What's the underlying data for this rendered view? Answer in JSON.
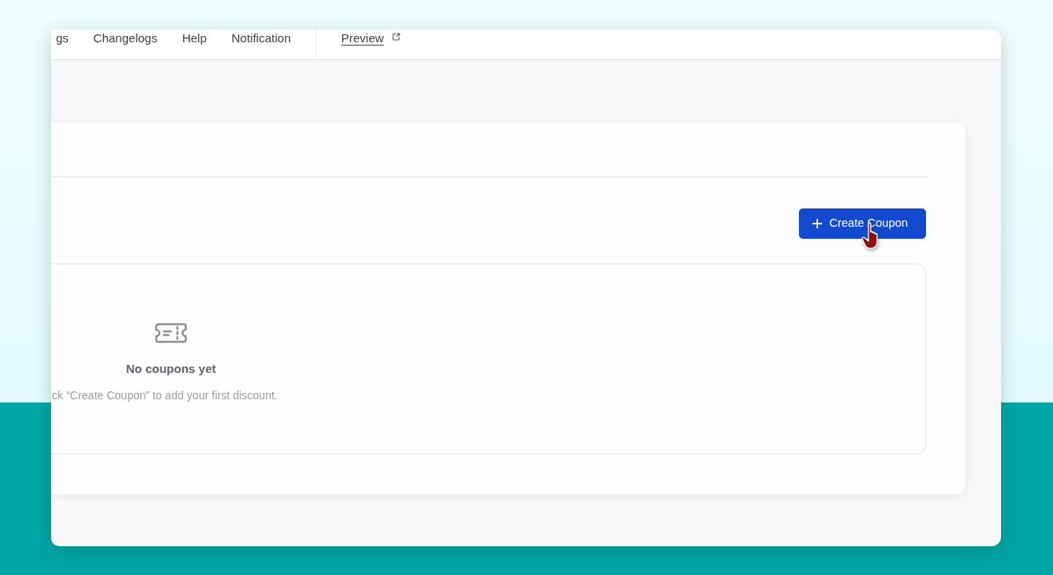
{
  "top_nav": {
    "items": [
      "gs",
      "Changelogs",
      "Help",
      "Notification"
    ],
    "preview_link": "Preview"
  },
  "coupons_card": {
    "create_button": "Create Coupon",
    "empty_state": {
      "title": "No coupons yet",
      "message": "ck “Create Coupon” to add your first discount."
    }
  }
}
